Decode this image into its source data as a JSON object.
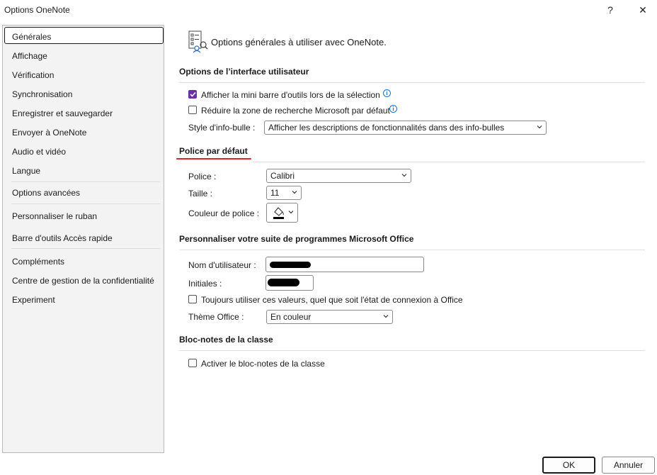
{
  "window": {
    "title": "Options OneNote",
    "help_label": "?",
    "close_label": "✕"
  },
  "sidebar": {
    "items": [
      {
        "label": "Générales"
      },
      {
        "label": "Affichage"
      },
      {
        "label": "Vérification"
      },
      {
        "label": "Synchronisation"
      },
      {
        "label": "Enregistrer et sauvegarder"
      },
      {
        "label": "Envoyer à OneNote"
      },
      {
        "label": "Audio et vidéo"
      },
      {
        "label": "Langue"
      },
      {
        "label": "Options avancées"
      },
      {
        "label": "Personnaliser le ruban"
      },
      {
        "label": "Barre d'outils Accès rapide"
      },
      {
        "label": "Compléments"
      },
      {
        "label": "Centre de gestion de la confidentialité"
      },
      {
        "label": "Experiment"
      }
    ],
    "selected": "Générales"
  },
  "header": {
    "title": "Options générales à utiliser avec OneNote.",
    "icon": "options-page-icon"
  },
  "ui_options": {
    "title": "Options de l’interface utilisateur",
    "mini_toolbar": {
      "label": "Afficher la mini barre d'outils lors de la sélection",
      "checked": true
    },
    "collapse_search": {
      "label": "Réduire la zone de recherche Microsoft par défaut",
      "checked": false
    },
    "tooltip_style": {
      "label": "Style d'info-bulle :",
      "value": "Afficher les descriptions de fonctionnalités dans des info-bulles"
    }
  },
  "default_font": {
    "title": "Police par défaut",
    "font": {
      "label": "Police :",
      "value": "Calibri"
    },
    "size": {
      "label": "Taille :",
      "value": "11"
    },
    "color": {
      "label": "Couleur de police :"
    },
    "accent_underline_color": "#d7262f"
  },
  "personalize": {
    "title": "Personnaliser votre suite de programmes Microsoft Office",
    "username": {
      "label": "Nom d'utilisateur :"
    },
    "initials": {
      "label": "Initiales :"
    },
    "always_use": {
      "label": "Toujours utiliser ces valeurs, quel que soit l'état de connexion à Office",
      "checked": false
    },
    "theme": {
      "label": "Thème Office :",
      "value": "En couleur"
    }
  },
  "class_notebook": {
    "title": "Bloc-notes de la classe",
    "enable": {
      "label": "Activer le bloc-notes de la classe",
      "checked": false
    }
  },
  "footer": {
    "ok_label": "OK",
    "cancel_label": "Annuler"
  },
  "colors": {
    "checkbox_accent": "#6b2fa3",
    "info_icon": "#1e6fd0"
  }
}
